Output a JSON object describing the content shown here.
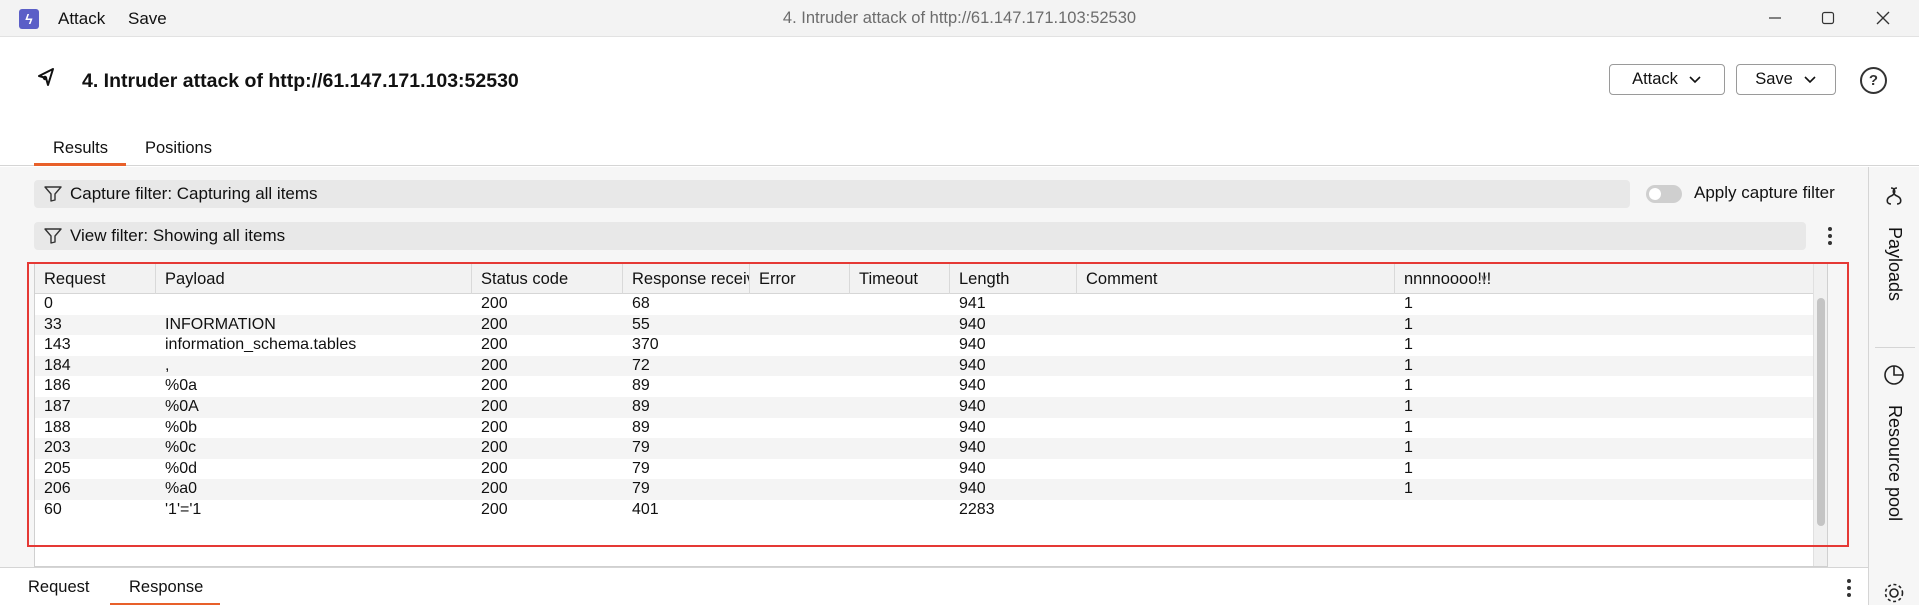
{
  "titlebar": {
    "menu": [
      "Attack",
      "Save"
    ],
    "title": "4. Intruder attack of http://61.147.171.103:52530"
  },
  "header": {
    "title": "4. Intruder attack of http://61.147.171.103:52530",
    "attack_button": "Attack",
    "save_button": "Save",
    "help": "?"
  },
  "tabs": [
    "Results",
    "Positions"
  ],
  "filters": {
    "capture": "Capture filter: Capturing all items",
    "view": "View filter: Showing all items",
    "apply_capture": "Apply capture filter"
  },
  "table": {
    "columns": [
      "Request",
      "Payload",
      "Status code",
      "Response received",
      "Error",
      "Timeout",
      "Length",
      "Comment",
      "nnnnoooo!!!"
    ],
    "rows": [
      [
        "0",
        "",
        "200",
        "68",
        "",
        "",
        "941",
        "",
        "1"
      ],
      [
        "33",
        "INFORMATION",
        "200",
        "55",
        "",
        "",
        "940",
        "",
        "1"
      ],
      [
        "143",
        "information_schema.tables",
        "200",
        "370",
        "",
        "",
        "940",
        "",
        "1"
      ],
      [
        "184",
        ",",
        "200",
        "72",
        "",
        "",
        "940",
        "",
        "1"
      ],
      [
        "186",
        "%0a",
        "200",
        "89",
        "",
        "",
        "940",
        "",
        "1"
      ],
      [
        "187",
        "%0A",
        "200",
        "89",
        "",
        "",
        "940",
        "",
        "1"
      ],
      [
        "188",
        "%0b",
        "200",
        "89",
        "",
        "",
        "940",
        "",
        "1"
      ],
      [
        "203",
        "%0c",
        "200",
        "79",
        "",
        "",
        "940",
        "",
        "1"
      ],
      [
        "205",
        "%0d",
        "200",
        "79",
        "",
        "",
        "940",
        "",
        "1"
      ],
      [
        "206",
        "%a0",
        "200",
        "79",
        "",
        "",
        "940",
        "",
        "1"
      ],
      [
        "60",
        "'1'='1",
        "200",
        "401",
        "",
        "",
        "2283",
        "",
        ""
      ]
    ]
  },
  "bottom_tabs": [
    "Request",
    "Response"
  ],
  "side_panel": {
    "payloads": "Payloads",
    "resource_pool": "Resource pool"
  },
  "colors": {
    "accent": "#e8602a",
    "highlight": "#e53935",
    "app_logo": "#5b5fc7"
  }
}
